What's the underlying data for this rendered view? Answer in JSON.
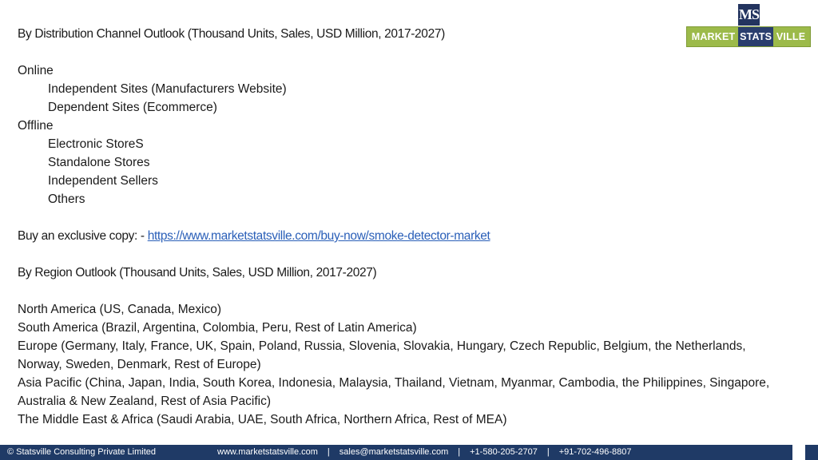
{
  "logo": {
    "mark": "MS",
    "word1": "MARKET",
    "word2": "STATS",
    "word3": "VILLE"
  },
  "sections": {
    "channel_heading": "By Distribution Channel Outlook (Thousand Units, Sales, USD Million, 2017-2027)",
    "online": "Online",
    "online_items": [
      "Independent Sites (Manufacturers Website)",
      "Dependent Sites (Ecommerce)"
    ],
    "offline": "Offline",
    "offline_items": [
      "Electronic StoreS",
      "Standalone Stores",
      "Independent Sellers",
      "Others"
    ],
    "buy_label": "Buy an exclusive copy: - ",
    "buy_link": "https://www.marketstatsville.com/buy-now/smoke-detector-market",
    "region_heading": "By Region Outlook (Thousand Units, Sales, USD Million, 2017-2027)",
    "regions": [
      "North America (US, Canada, Mexico)",
      "South America (Brazil, Argentina, Colombia, Peru, Rest of Latin America)",
      "Europe (Germany, Italy, France, UK, Spain, Poland, Russia, Slovenia, Slovakia, Hungary, Czech Republic, Belgium, the Netherlands, Norway, Sweden, Denmark, Rest of Europe)",
      "Asia Pacific (China, Japan, India, South Korea, Indonesia, Malaysia, Thailand, Vietnam, Myanmar, Cambodia, the Philippines, Singapore, Australia & New Zealand, Rest of Asia Pacific)",
      "The Middle East & Africa (Saudi Arabia, UAE, South Africa, Northern Africa, Rest of MEA)"
    ]
  },
  "footer": {
    "copyright": "© Statsville Consulting Private Limited",
    "website": "www.marketstatsville.com",
    "email": "sales@marketstatsville.com",
    "phone1": "+1-580-205-2707",
    "phone2": "+91-702-496-8807",
    "separator": "|"
  }
}
